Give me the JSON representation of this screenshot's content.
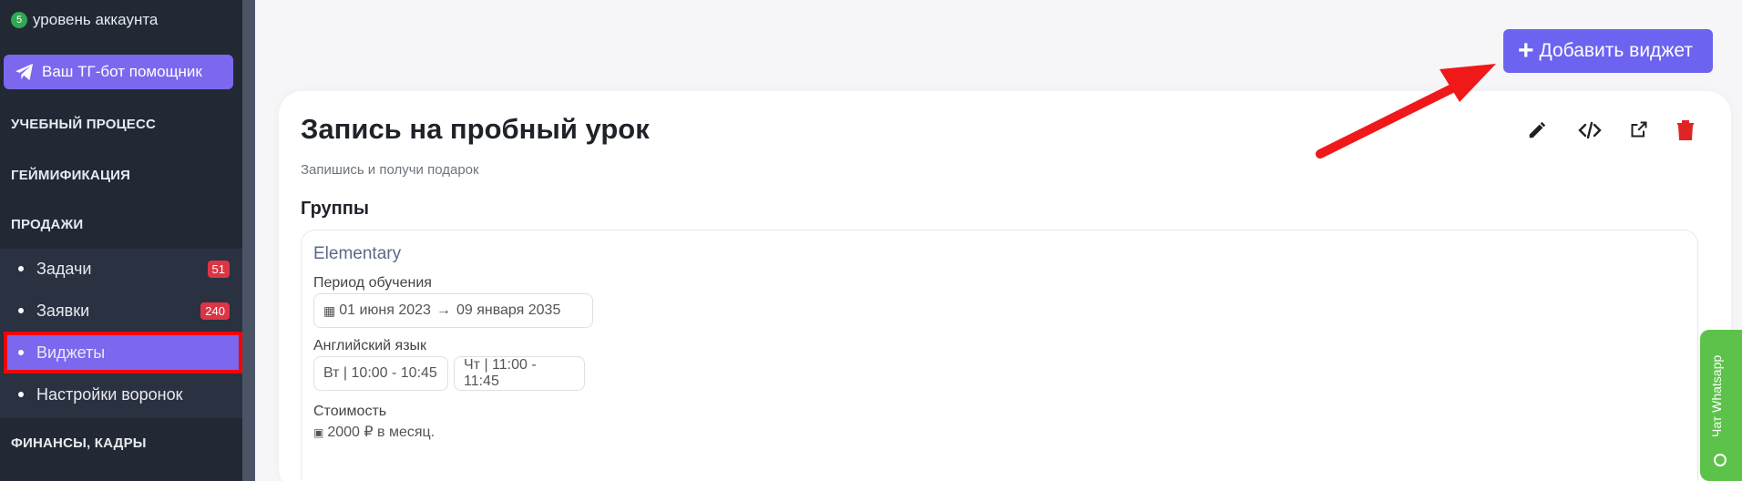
{
  "sidebar": {
    "account_level": "5",
    "account_label": "уровень аккаунта",
    "tg_button": "Ваш ТГ-бот помощник",
    "sections": [
      "УЧЕБНЫЙ ПРОЦЕСС",
      "ГЕЙМИФИКАЦИЯ",
      "ПРОДАЖИ",
      "ФИНАНСЫ, КАДРЫ"
    ],
    "items": [
      {
        "label": "Задачи",
        "badge": "51"
      },
      {
        "label": "Заявки",
        "badge": "240"
      },
      {
        "label": "Виджеты",
        "badge": ""
      },
      {
        "label": "Настройки воронок",
        "badge": ""
      }
    ]
  },
  "main": {
    "add_button": "Добавить виджет",
    "title": "Запись на пробный урок",
    "subtitle": "Запишись и получи подарок",
    "groups_heading": "Группы",
    "group": {
      "name": "Elementary",
      "period_label": "Период обучения",
      "period_start": "01 июня 2023",
      "period_end": "09 января 2035",
      "subject_label": "Английский язык",
      "schedule": [
        "Вт | 10:00 - 10:45",
        "Чт | 11:00 - 11:45"
      ],
      "cost_label": "Стоимость",
      "cost_value": "2000 ₽ в месяц."
    }
  },
  "whatsapp": {
    "label": "Чат Whatsapp"
  },
  "colors": {
    "accent": "#6c63f0",
    "danger": "#dc3545",
    "sidebar": "#222935",
    "highlight": "#ff0000"
  }
}
